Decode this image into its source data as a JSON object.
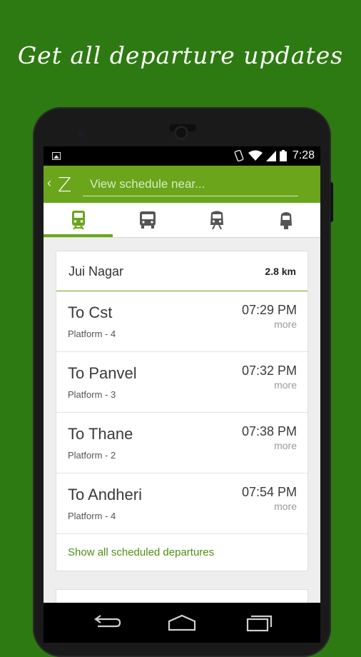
{
  "headline": "Get all departure updates",
  "status_bar": {
    "time": "7:28"
  },
  "app_bar": {
    "logo": "Z",
    "search_placeholder": "View schedule near..."
  },
  "tabs": [
    {
      "icon": "train-icon",
      "active": true
    },
    {
      "icon": "bus-icon",
      "active": false
    },
    {
      "icon": "metro-icon",
      "active": false
    },
    {
      "icon": "monorail-icon",
      "active": false
    }
  ],
  "station": {
    "name": "Jui Nagar",
    "distance": "2.8 km"
  },
  "departures": [
    {
      "destination": "To Cst",
      "platform": "Platform - 4",
      "time": "07:29 PM",
      "more": "more"
    },
    {
      "destination": "To Panvel",
      "platform": "Platform - 3",
      "time": "07:32 PM",
      "more": "more"
    },
    {
      "destination": "To Thane",
      "platform": "Platform - 2",
      "time": "07:38 PM",
      "more": "more"
    },
    {
      "destination": "To Andheri",
      "platform": "Platform - 4",
      "time": "07:54 PM",
      "more": "more"
    }
  ],
  "show_all_label": "Show all scheduled departures",
  "colors": {
    "brand_green": "#6aa51c",
    "background_green": "#2e7a12",
    "link_green": "#4f8f12"
  }
}
